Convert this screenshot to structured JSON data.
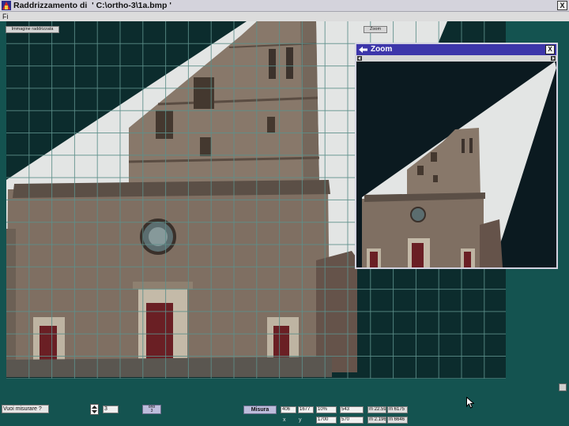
{
  "window": {
    "title": "Raddrizzamento di  ' C:\\ortho-3\\1a.bmp '",
    "close_label": "X"
  },
  "menu": {
    "file": "Fi"
  },
  "toolbar": {
    "rectified_image_button": "Immagine raddrizzata",
    "zoom_button": "Zoom"
  },
  "zoom_window": {
    "title": "Zoom",
    "close_label": "X"
  },
  "measure_panel": {
    "prompt": "Vuoi misurare ?",
    "spinner_value": "3",
    "ortho_button": {
      "line1": "orto",
      "line2": "3"
    },
    "measure_button": "Misura",
    "row1": [
      "406",
      "1677",
      "10%",
      "543",
      "m 22.59",
      "m 6175"
    ],
    "row2_labels": [
      "x",
      "y"
    ],
    "row2": [
      "1700",
      "570",
      "m 2.196",
      "m 6646"
    ]
  },
  "icons": {
    "app": "app-icon",
    "window_close": "close-icon",
    "zoom_back": "back-arrow-icon",
    "zoom_close": "close-icon",
    "scroll_left": "arrow-left-icon",
    "scroll_right": "arrow-right-icon",
    "spinner": "spinner-arrows-icon",
    "cursor": "mouse-pointer-icon"
  },
  "colors": {
    "titlebar": "#d4d3dc",
    "workspace": "#145350",
    "canvas": "#0c2c2d",
    "grid": "#5d8f8a",
    "zoom_title": "#3d36aa",
    "zoom_background": "#0b1a20",
    "button": "#bdbddc",
    "door": "#6a1f24"
  }
}
